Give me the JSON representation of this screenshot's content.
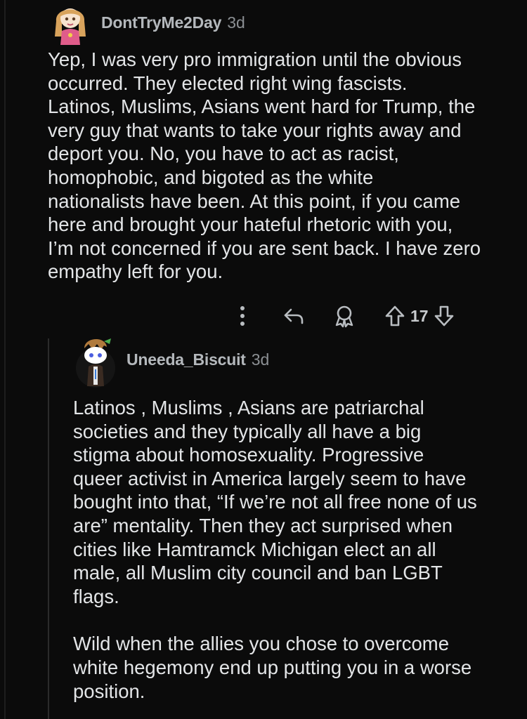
{
  "comments": [
    {
      "username": "DontTryMe2Day",
      "age": "3d",
      "avatar_icon": "cartoon-girl-avatar-icon",
      "body_lines": [
        "Yep, I was very pro immigration until the obvious",
        "occurred. They elected right wing fascists.",
        "Latinos, Muslims, Asians went hard for Trump, the",
        "very guy that wants to take your rights away and",
        "deport you. No, you have to act as racist,",
        "homophobic, and bigoted as the white",
        "nationalists have been. At this point, if you came",
        "here and brought your hateful rhetoric with you,",
        "I’m not concerned if you are sent back. I have zero",
        "empathy left for you."
      ],
      "actions": {
        "more_icon": "more-vertical-icon",
        "reply_icon": "reply-icon",
        "award_icon": "award-icon",
        "upvote_icon": "upvote-arrow-icon",
        "score": "17",
        "downvote_icon": "downvote-arrow-icon"
      }
    },
    {
      "username": "Uneeda_Biscuit",
      "age": "3d",
      "avatar_icon": "snoo-avatar-icon",
      "paragraph1_lines": [
        "Latinos , Muslims , Asians are patriarchal",
        "societies and they typically all have a big",
        "stigma about homosexuality. Progressive",
        "queer activist in America largely seem to have",
        "bought into that, “If we’re not all free none of us",
        "are” mentality. Then they act surprised when",
        "cities like Hamtramck Michigan elect an all",
        "male, all Muslim city council and ban LGBT",
        "flags."
      ],
      "paragraph2_lines": [
        "Wild when the allies you chose to overcome",
        "white hegemony end up putting you in a worse",
        "position."
      ]
    }
  ],
  "colors": {
    "background": "#0b0b0b",
    "text": "#e3e5e7",
    "username": "#b4b8bc",
    "muted": "#8b8f93"
  }
}
